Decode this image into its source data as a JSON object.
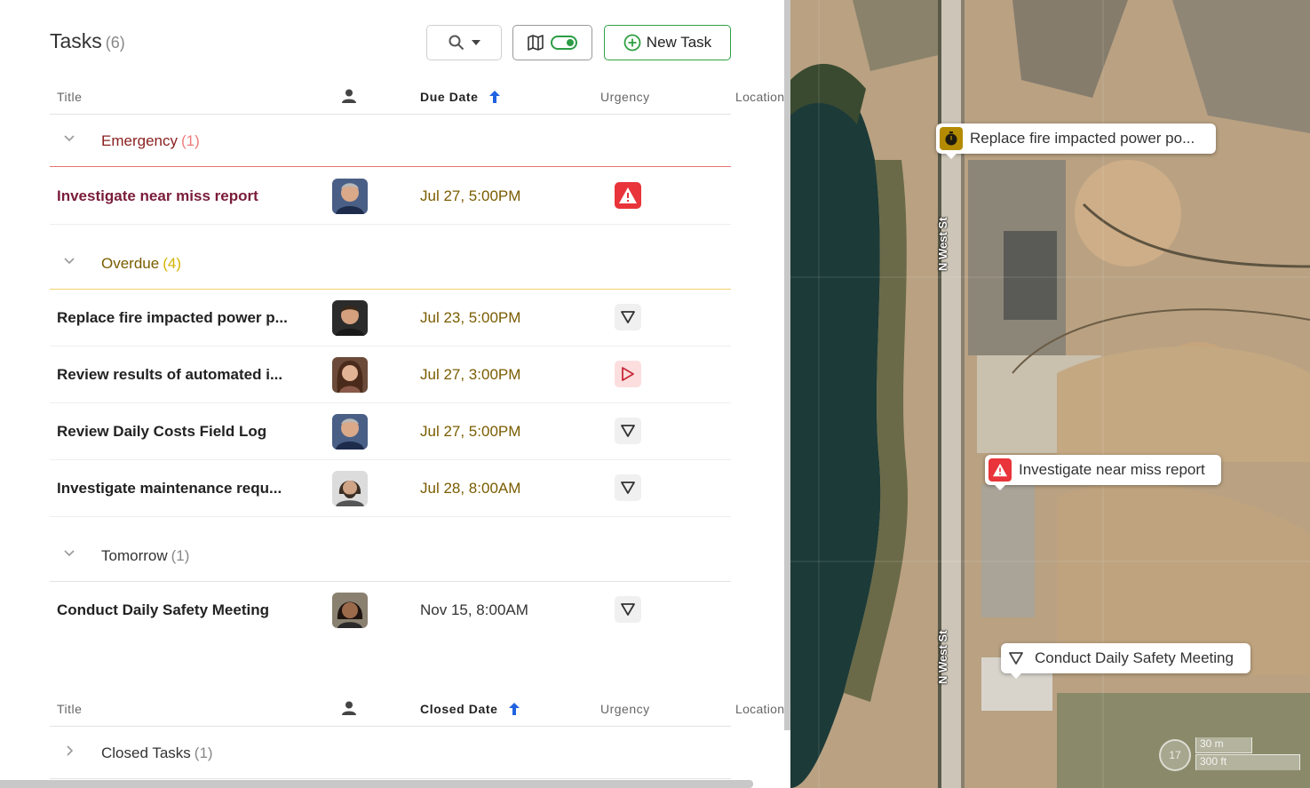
{
  "header": {
    "title": "Tasks",
    "count": "(6)",
    "new_task_label": "New Task",
    "icons": [
      "search-icon",
      "chevron-down-icon",
      "map-icon",
      "toggle-switch",
      "plus-circle-icon"
    ]
  },
  "open_table": {
    "columns": {
      "title": "Title",
      "due_date": "Due Date",
      "urgency": "Urgency",
      "location": "Location"
    },
    "groups": [
      {
        "label": "Emergency",
        "count": "(1)",
        "color": "#e8343a",
        "tasks": [
          {
            "title": "Investigate near miss report",
            "date": "Jul 27, 5:00PM",
            "urgency": "emergency"
          }
        ]
      },
      {
        "label": "Overdue",
        "count": "(4)",
        "color": "#f0d36c",
        "tasks": [
          {
            "title": "Replace fire impacted power p...",
            "date": "Jul 23, 5:00PM",
            "urgency": "low"
          },
          {
            "title": "Review results of automated i...",
            "date": "Jul 27, 3:00PM",
            "urgency": "medium"
          },
          {
            "title": "Review Daily Costs Field Log",
            "date": "Jul 27, 5:00PM",
            "urgency": "low"
          },
          {
            "title": "Investigate maintenance requ...",
            "date": "Jul 28, 8:00AM",
            "urgency": "low"
          }
        ]
      },
      {
        "label": "Tomorrow",
        "count": "(1)",
        "color": "#e3e3e3",
        "tasks": [
          {
            "title": "Conduct Daily Safety Meeting",
            "date": "Nov 15, 8:00AM",
            "urgency": "low"
          }
        ]
      }
    ]
  },
  "closed_table": {
    "columns": {
      "title": "Title",
      "closed_date": "Closed Date",
      "urgency": "Urgency",
      "location": "Location"
    },
    "group": {
      "label": "Closed Tasks",
      "count": "(1)"
    }
  },
  "map": {
    "road_label": "N West St",
    "pins": [
      {
        "label": "Replace fire impacted power po...",
        "icon": "stopwatch-icon",
        "color": "#b38a00"
      },
      {
        "label": "Investigate near miss report",
        "icon": "warning-icon",
        "color": "#e8343a"
      },
      {
        "label": "Conduct Daily Safety Meeting",
        "icon": "triangle-down-icon",
        "color": "#444444"
      }
    ],
    "scale": {
      "zoom": "17",
      "meters": "30 m",
      "feet": "300 ft"
    }
  }
}
